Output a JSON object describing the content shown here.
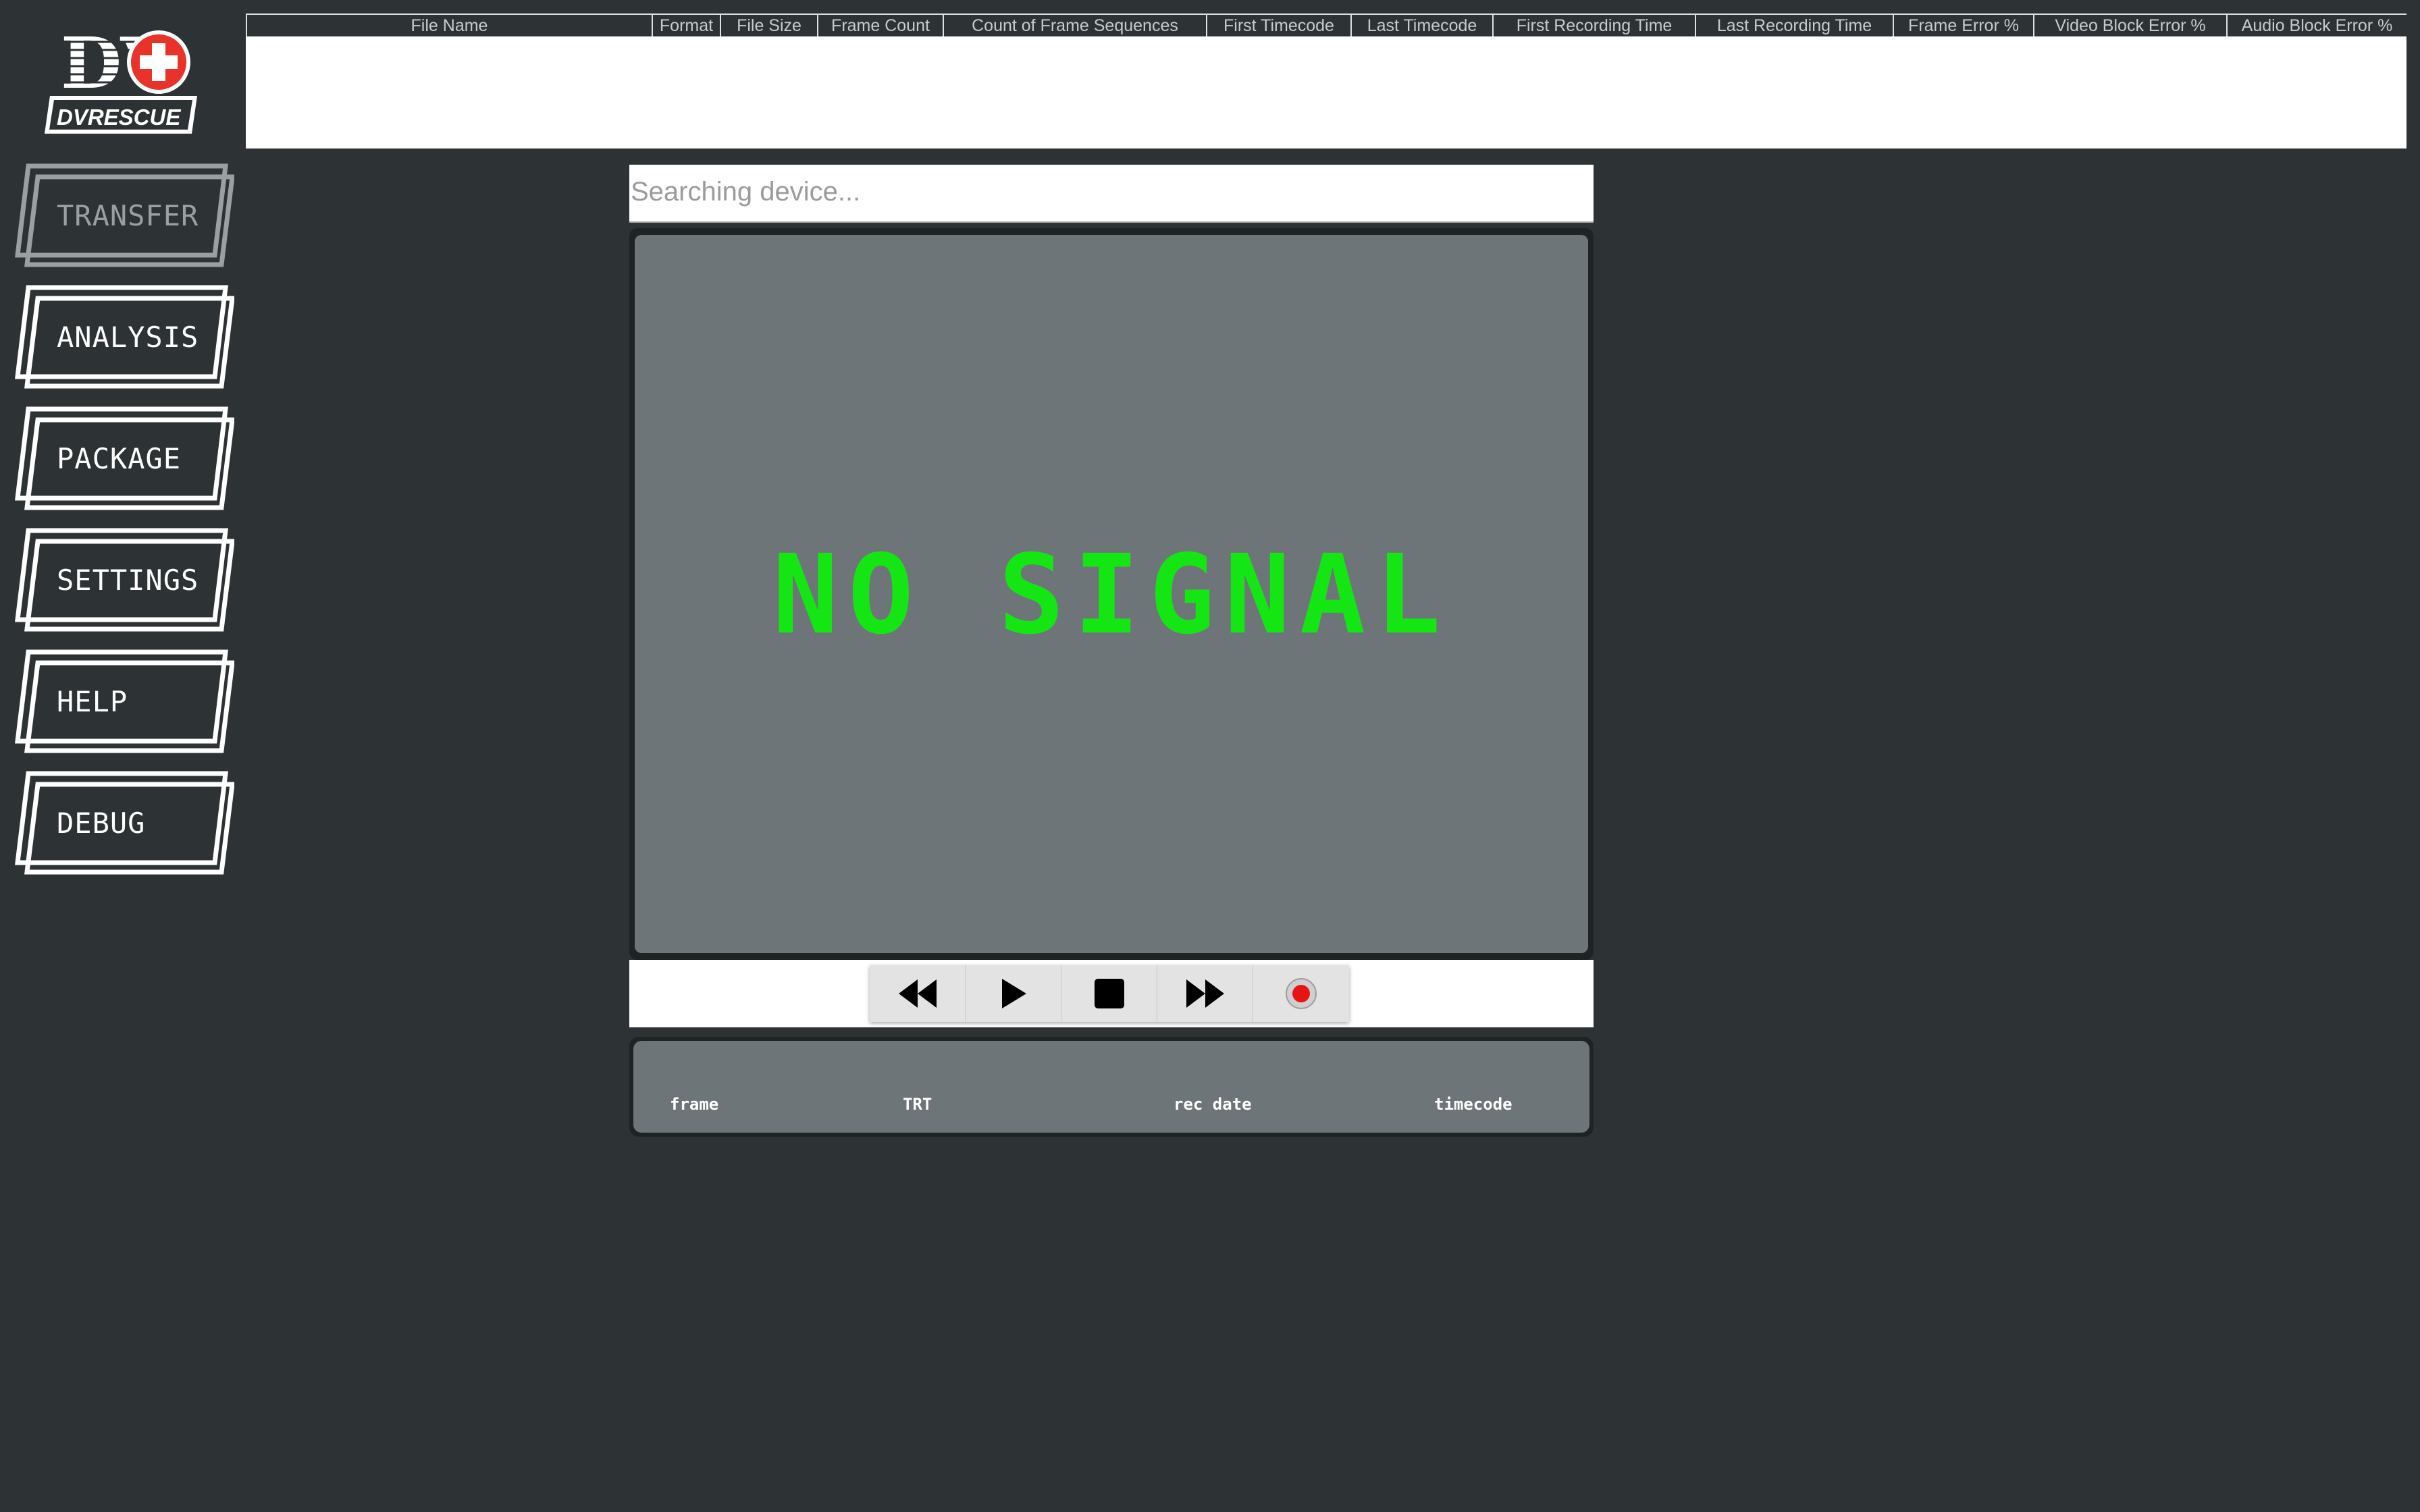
{
  "app": {
    "logo_text": "DVRESCUE",
    "logo_monogram": "DV"
  },
  "sidebar": {
    "items": [
      {
        "label": "TRANSFER",
        "active": true
      },
      {
        "label": "ANALYSIS",
        "active": false
      },
      {
        "label": "PACKAGE",
        "active": false
      },
      {
        "label": "SETTINGS",
        "active": false
      },
      {
        "label": "HELP",
        "active": false
      },
      {
        "label": "DEBUG",
        "active": false
      }
    ]
  },
  "file_table": {
    "columns": [
      "File Name",
      "Format",
      "File Size",
      "Frame Count",
      "Count of Frame Sequences",
      "First Timecode",
      "Last Timecode",
      "First Recording Time",
      "Last Recording Time",
      "Frame Error %",
      "Video Block Error %",
      "Audio Block Error %"
    ],
    "rows": []
  },
  "device": {
    "status_text": "Searching device..."
  },
  "monitor": {
    "message": "NO SIGNAL"
  },
  "transport": {
    "buttons": [
      {
        "icon": "rewind-icon"
      },
      {
        "icon": "play-icon"
      },
      {
        "icon": "stop-icon"
      },
      {
        "icon": "fast-forward-icon"
      },
      {
        "icon": "record-icon"
      }
    ]
  },
  "info_panel": {
    "frame_label": "frame",
    "trt_label": "TRT",
    "rec_date_label": "rec date",
    "timecode_label": "timecode"
  },
  "colors": {
    "background": "#2d3335",
    "no_signal": "#14e614",
    "screen": "#6e7578",
    "logo_red": "#e8322a",
    "record_red": "#e81414"
  }
}
